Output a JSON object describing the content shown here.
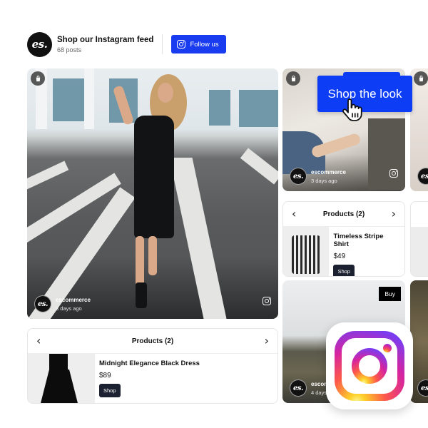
{
  "header": {
    "logo_text": "es.",
    "title": "Shop our Instagram feed",
    "post_count": "68 posts",
    "follow_label": "Follow us"
  },
  "posts": [
    {
      "username": "escommerce",
      "time": "3 days ago",
      "avatar_text": "es."
    },
    {
      "username": "escommerce",
      "time": "3 days ago",
      "avatar_text": "es."
    },
    {
      "username": "escommerce",
      "time": "4 days ago",
      "avatar_text": "es."
    }
  ],
  "products_main": {
    "title": "Products (2)",
    "prev_icon": "‹",
    "next_icon": "›",
    "name": "Midnight Elegance Black Dress",
    "price": "$89",
    "shop_label": "Shop"
  },
  "products_side": {
    "title": "Products (2)",
    "prev_icon": "‹",
    "next_icon": "›",
    "name": "Timeless Stripe Shirt",
    "price": "$49",
    "shop_label": "Shop"
  },
  "shop_the_look_label": "Shop the look",
  "buy_label": "Buy",
  "colors": {
    "brand_blue": "#1a3cf0",
    "shop_button": "#1b2130"
  }
}
